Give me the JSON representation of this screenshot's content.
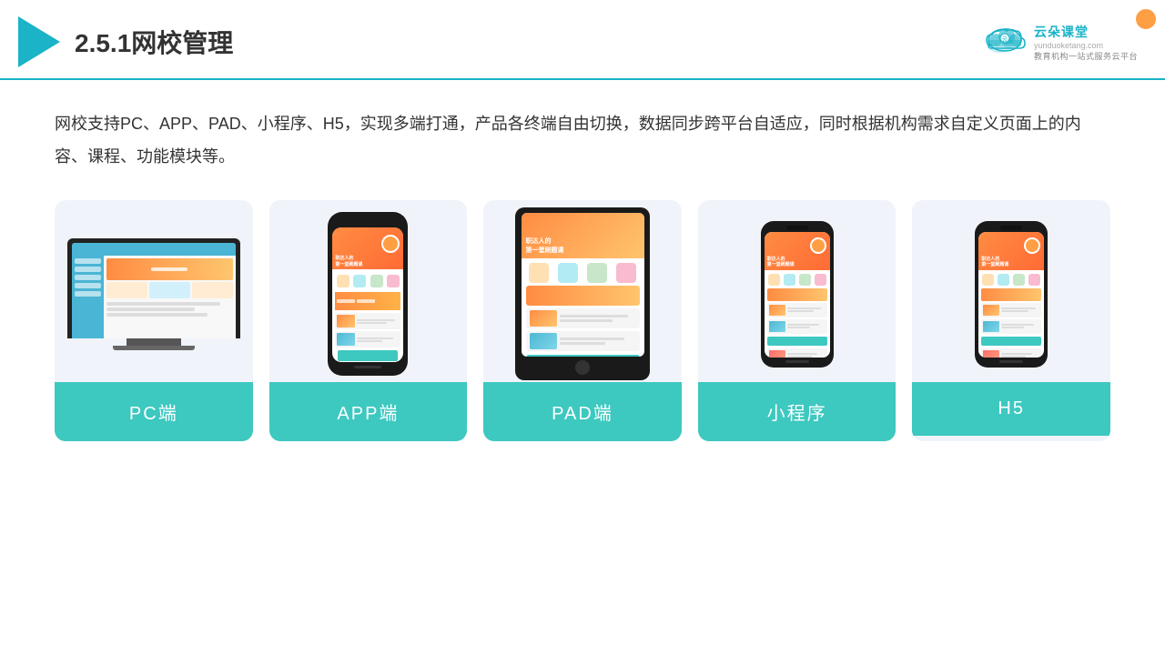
{
  "header": {
    "title": "2.5.1网校管理",
    "brand": {
      "name": "云朵课堂",
      "url": "yunduoketang.com",
      "tagline": "教育机构一站式服务云平台"
    }
  },
  "description": "网校支持PC、APP、PAD、小程序、H5，实现多端打通，产品各终端自由切换，数据同步跨平台自适应，同时根据机构需求自定义页面上的内容、课程、功能模块等。",
  "cards": [
    {
      "id": "pc",
      "label": "PC端"
    },
    {
      "id": "app",
      "label": "APP端"
    },
    {
      "id": "pad",
      "label": "PAD端"
    },
    {
      "id": "miniprogram",
      "label": "小程序"
    },
    {
      "id": "h5",
      "label": "H5"
    }
  ],
  "colors": {
    "teal": "#3dc8c0",
    "accent_orange": "#ff8c42",
    "header_border": "#1ab3c8",
    "card_bg": "#eef2fa"
  }
}
